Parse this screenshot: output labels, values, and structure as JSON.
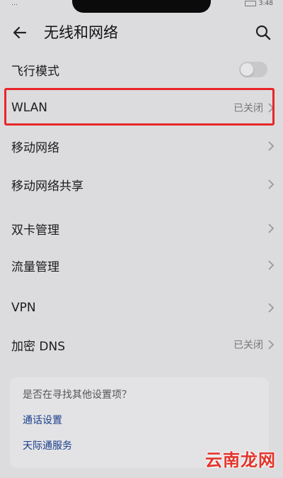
{
  "status_bar": {
    "left": "…",
    "time": "3:48"
  },
  "header": {
    "title": "无线和网络"
  },
  "rows": [
    {
      "label": "飞行模式",
      "type": "toggle",
      "toggle_on": false
    },
    {
      "label": "WLAN",
      "status": "已关闭"
    },
    {
      "label": "移动网络"
    },
    {
      "label": "移动网络共享"
    },
    {
      "label": "双卡管理"
    },
    {
      "label": "流量管理"
    },
    {
      "label": "VPN"
    },
    {
      "label": "加密 DNS",
      "status": "已关闭"
    }
  ],
  "suggestions": {
    "question": "是否在寻找其他设置项？",
    "links": [
      "通话设置",
      "天际通服务"
    ]
  },
  "watermark": "云南龙网",
  "colors": {
    "highlight": "#e8262a",
    "link": "#1a3e8c",
    "background": "#dcdcde"
  }
}
